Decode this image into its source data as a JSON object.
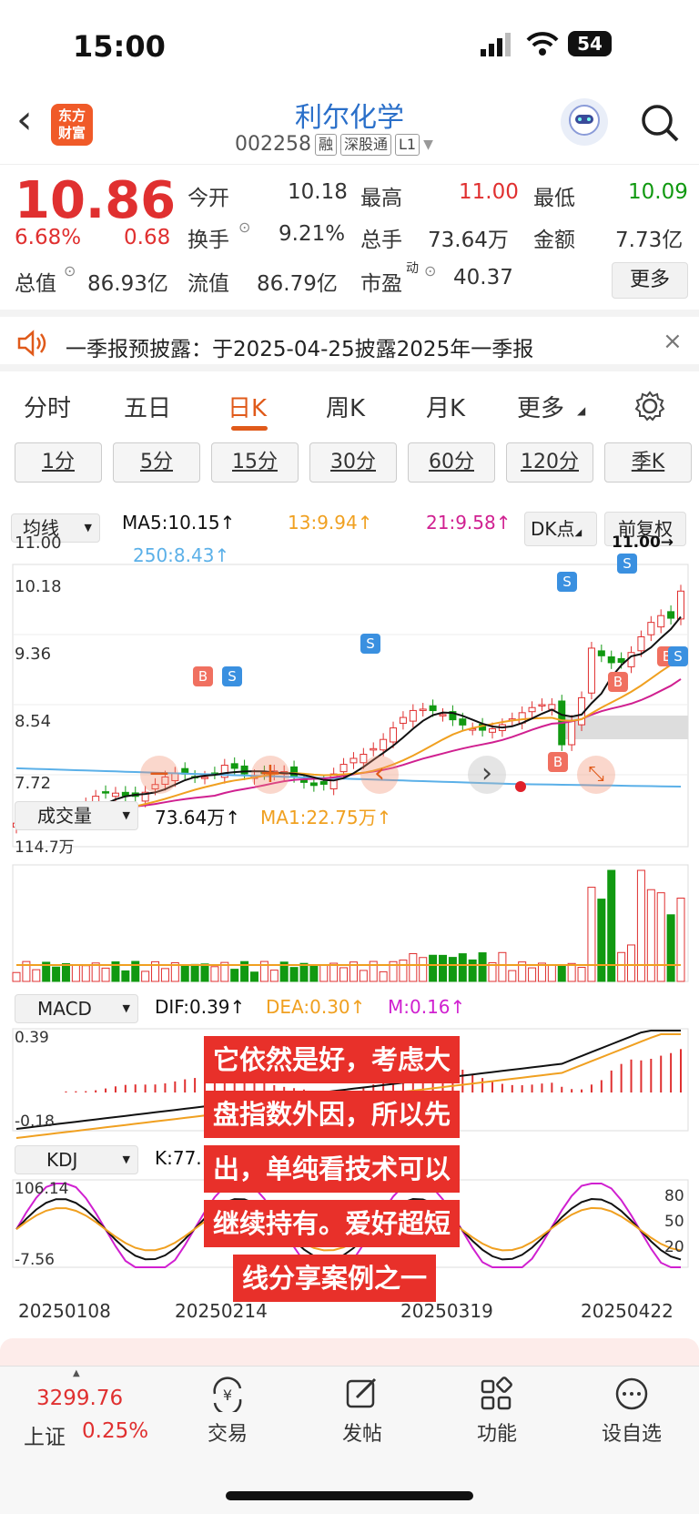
{
  "status_bar": {
    "time": "15:00",
    "battery": "54"
  },
  "header": {
    "back_icon": "chevron-left-icon",
    "logo_text": "东方\n财富",
    "logo_line1": "东方",
    "logo_line2": "财富",
    "stock_name": "利尔化学",
    "stock_code": "002258",
    "tags": [
      "融",
      "深股通",
      "L1"
    ]
  },
  "quote": {
    "price": "10.86",
    "change_pct": "6.68%",
    "change": "0.68",
    "open_label": "今开",
    "open": "10.18",
    "high_label": "最高",
    "high": "11.00",
    "low_label": "最低",
    "low": "10.09",
    "turnover_label": "换手",
    "turnover": "9.21%",
    "volume_label": "总手",
    "volume": "73.64万",
    "amount_label": "金额",
    "amount": "7.73亿",
    "mktcap_label": "总值",
    "mktcap": "86.93亿",
    "float_label": "流值",
    "float": "86.79亿",
    "pe_label": "市盈",
    "pe_sup": "动",
    "pe": "40.37",
    "more_label": "更多"
  },
  "notice": {
    "text": "一季报预披露：于2025-04-25披露2025年一季报"
  },
  "tabs": [
    {
      "label": "分时"
    },
    {
      "label": "五日"
    },
    {
      "label": "日K"
    },
    {
      "label": "周K"
    },
    {
      "label": "月K"
    },
    {
      "label": "更多"
    }
  ],
  "periods": [
    "1分",
    "5分",
    "15分",
    "30分",
    "60分",
    "120分",
    "季K"
  ],
  "kline": {
    "ma_selector": "均线",
    "ma5": "MA5:10.15↑",
    "ma13": "13:9.94↑",
    "ma21": "21:9.58↑",
    "ma250": "250:8.43↑",
    "dk_button": "DK点",
    "adjust_button": "前复权",
    "y_labels": [
      "11.00",
      "10.18",
      "9.36",
      "8.54",
      "7.72"
    ],
    "high_marker": "11.00→",
    "colors": {
      "ma5": "#111111",
      "ma13": "#f0a020",
      "ma21": "#d02090",
      "ma250": "#5bb0e8",
      "up": "#e03030",
      "down": "#119911"
    }
  },
  "volume": {
    "selector": "成交量",
    "value": "73.64万↑",
    "ma1": "MA1:22.75万↑",
    "max_label": "114.7万"
  },
  "macd": {
    "selector": "MACD",
    "dif": "DIF:0.39↑",
    "dea": "DEA:0.30↑",
    "m": "M:0.16↑",
    "top_label": "0.39",
    "bottom_label": "-0.18"
  },
  "kdj": {
    "selector": "KDJ",
    "k": "K:77.",
    "top_label": "106.14",
    "bottom_label": "-7.56",
    "levels": [
      "80",
      "50",
      "20"
    ]
  },
  "dates": [
    "20250108",
    "20250214",
    "20250319",
    "20250422"
  ],
  "overlay_text": [
    "它依然是好，考虑大",
    "盘指数外因，所以先",
    "出，单纯看技术可以",
    "继续持有。爱好超短",
    "线分享案例之一"
  ],
  "bottom_bar": {
    "index_value": "3299.76",
    "index_name": "上证",
    "index_change": "0.25%",
    "items": [
      {
        "label": "交易"
      },
      {
        "label": "发帖"
      },
      {
        "label": "功能"
      },
      {
        "label": "设自选"
      }
    ]
  }
}
